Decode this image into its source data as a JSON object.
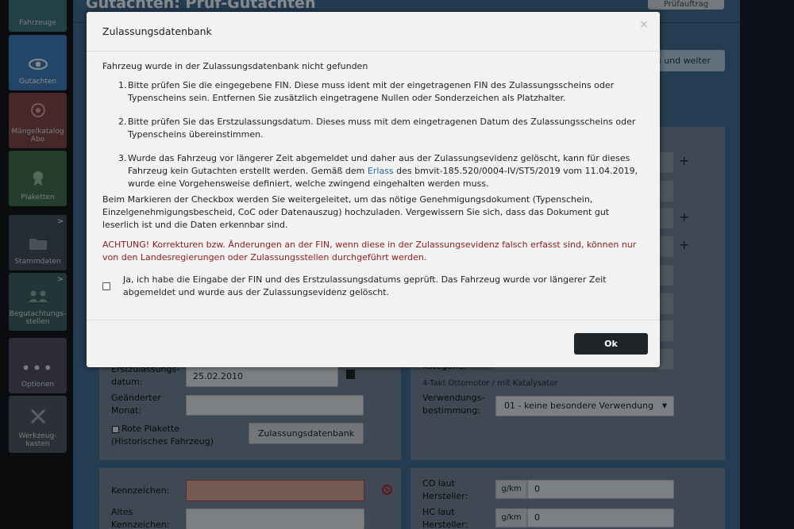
{
  "page_title": "Gutachten: Prüf-Gutachten",
  "top_button_label": "Prüfauftrag",
  "next_button_label": "n und weiter",
  "sidebar": {
    "items": [
      {
        "label": "Fahrzeuge",
        "icon": "car-icon"
      },
      {
        "label": "Gutachten",
        "icon": "eye-icon",
        "active": true
      },
      {
        "label": "Mängelkatalog Abo",
        "icon": "badge-icon"
      },
      {
        "label": "Plaketten",
        "icon": "seal-icon"
      },
      {
        "label": "Stammdaten",
        "icon": "folder-icon"
      },
      {
        "label": "Begutachtungs-stellen",
        "icon": "people-icon"
      },
      {
        "label": "Optionen",
        "icon": "dots-icon"
      },
      {
        "label": "Werkzeug-kasten",
        "icon": "tools-icon"
      }
    ],
    "expand_glyph": ">"
  },
  "form": {
    "erstzulassung_label": "Erstzulassungs-datum:",
    "erstzulassung_value": "25.02.2010",
    "geaenderter_monat_label": "Geänderter Monat:",
    "rote_plakette_label": "Rote Plakette (Historisches Fahrzeug)",
    "zulassungsdatenbank_button": "Zulassungsdatenbank",
    "antrieb_hint": "4-Takt Ottomotor / mit Katalysator",
    "verwendung_label": "Verwendungs-bestimmung:",
    "verwendung_value": "01 - keine besondere Verwendung",
    "kennzeichen_label": "Kennzeichen:",
    "altes_kennzeichen_label": "Altes Kennzeichen:",
    "co_label": "CO laut Hersteller:",
    "hc_label": "HC laut Hersteller:",
    "unit": "g/km",
    "co_value": "0",
    "hc_value": "0",
    "kategorie_label": "kategorie:"
  },
  "modal": {
    "title": "Zulassungsdatenbank",
    "close": "×",
    "intro": "Fahrzeug wurde in der Zulassungsdatenbank nicht gefunden",
    "steps": [
      {
        "num": "1.",
        "text": "Bitte prüfen Sie die eingegebene FIN. Diese muss ident mit der eingetragenen FIN des Zulassungsscheins oder Typenscheins sein. Entfernen Sie zusätzlich eingetragene Nullen oder Sonderzeichen als Platzhalter."
      },
      {
        "num": "2.",
        "text": "Bitte prüfen Sie das Erstzulassungsdatum. Dieses muss mit dem eingetragenen Datum des Zulassungsscheins oder Typenscheins übereinstimmen."
      },
      {
        "num": "3.",
        "text_before": "Wurde das Fahrzeug vor längerer Zeit abgemeldet und daher aus der Zulassungsevidenz gelöscht, kann für dieses Fahrzeug kein Gutachten erstellt werden. Gemäß dem ",
        "link": "Erlass",
        "text_after": " des bmvit-185.520/0004-IV/ST5/2019 vom 11.04.2019, wurde eine Vorgehensweise definiert, welche zwingend eingehalten werden muss."
      }
    ],
    "checkbox_info": "Beim Markieren der Checkbox werden Sie weitergeleitet, um das nötige Genehmigungsdokument (Typenschein, Einzelgenehmigungsbescheid, CoC oder Datenauszug) hochzuladen. Vergewissern Sie sich, dass das Dokument gut leserlich ist und die Daten erkennbar sind.",
    "warning": "ACHTUNG! Korrekturen bzw. Änderungen an der FIN, wenn diese in der Zulassungsevidenz falsch erfasst sind, können nur von den Landesregierungen oder Zulassungsstellen durchgeführt werden.",
    "confirm_text": "Ja, ich habe die Eingabe der FIN und des Erstzulassungsdatums geprüft. Das Fahrzeug wurde vor längerer Zeit abgemeldet und wurde aus der Zulassungsevidenz gelöscht.",
    "ok_label": "Ok"
  }
}
